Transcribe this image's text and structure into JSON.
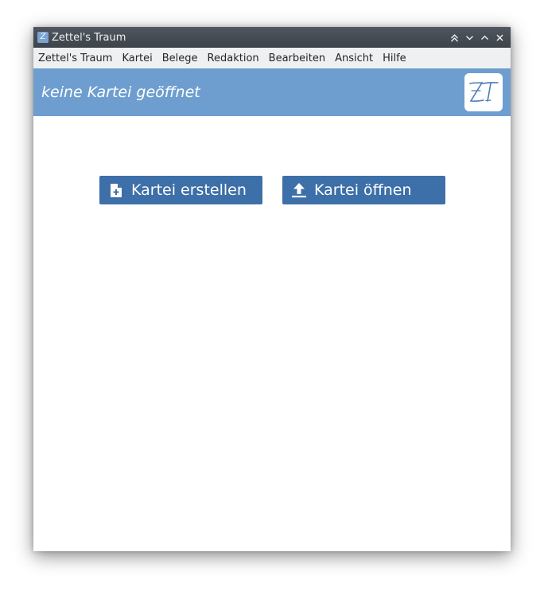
{
  "window": {
    "title": "Zettel's Traum",
    "app_icon_letter": "Z",
    "buttons": [
      "keep-above",
      "minimize",
      "maximize",
      "close"
    ]
  },
  "menu": {
    "items": [
      "Zettel's Traum",
      "Kartei",
      "Belege",
      "Redaktion",
      "Bearbeiten",
      "Ansicht",
      "Hilfe"
    ]
  },
  "banner": {
    "text": "keine Kartei geöffnet",
    "logo_text": "ZT",
    "color": "#6e9ecf"
  },
  "actions": {
    "create_label": "Kartei erstellen",
    "create_icon": "file-plus-icon",
    "open_label": "Kartei öffnen",
    "open_icon": "upload-icon",
    "color": "#3d6fa8"
  }
}
